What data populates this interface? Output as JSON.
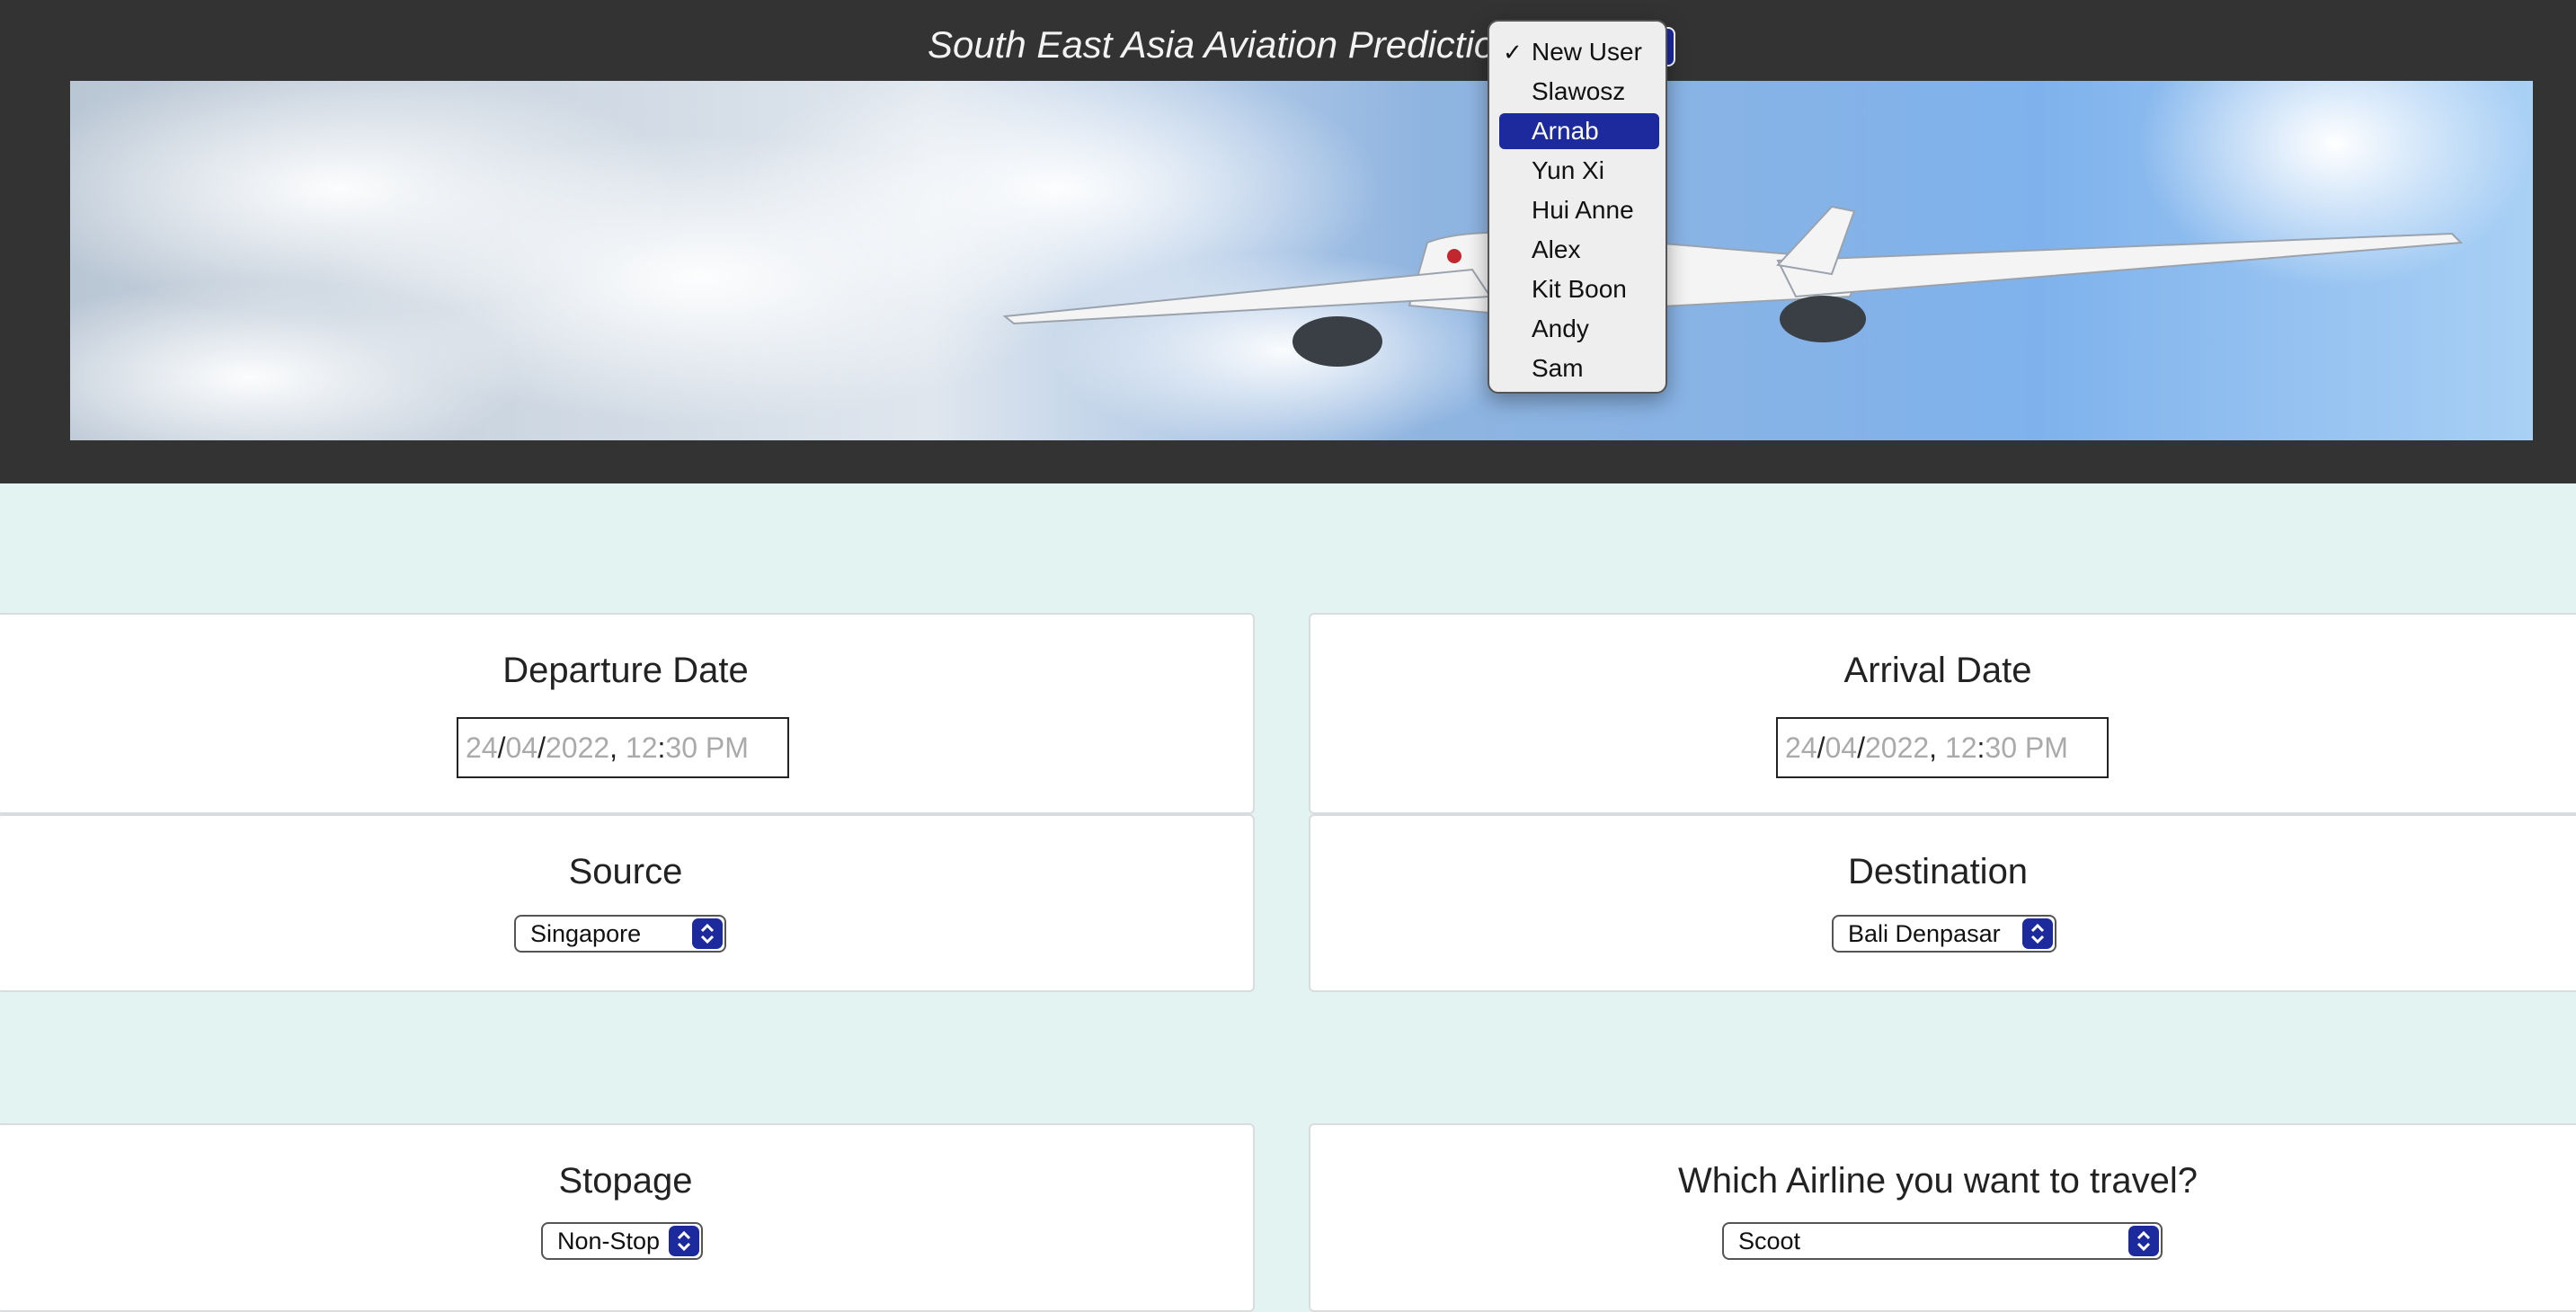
{
  "header": {
    "title": "South East Asia Aviation Prediction"
  },
  "user_menu": {
    "selected": "New User",
    "highlighted": "Arnab",
    "options": [
      "New User",
      "Slawosz",
      "Arnab",
      "Yun Xi",
      "Hui Anne",
      "Alex",
      "Kit Boon",
      "Andy",
      "Sam"
    ]
  },
  "banner": {
    "description_icon": "airplane-banner"
  },
  "form": {
    "departure": {
      "title": "Departure Date",
      "day": "24",
      "month": "04",
      "year": "2022",
      "hour": "12",
      "minute": "30",
      "period": "PM"
    },
    "arrival": {
      "title": "Arrival Date",
      "day": "24",
      "month": "04",
      "year": "2022",
      "hour": "12",
      "minute": "30",
      "period": "PM"
    },
    "source": {
      "title": "Source",
      "value": "Singapore"
    },
    "destination": {
      "title": "Destination",
      "value": "Bali Denpasar"
    },
    "stopage": {
      "title": "Stopage",
      "value": "Non-Stop"
    },
    "airline": {
      "title": "Which Airline you want to travel?",
      "value": "Scoot"
    }
  },
  "colors": {
    "header_bg": "#333333",
    "page_bg": "#e3f3f2",
    "accent": "#1c2a9e"
  }
}
